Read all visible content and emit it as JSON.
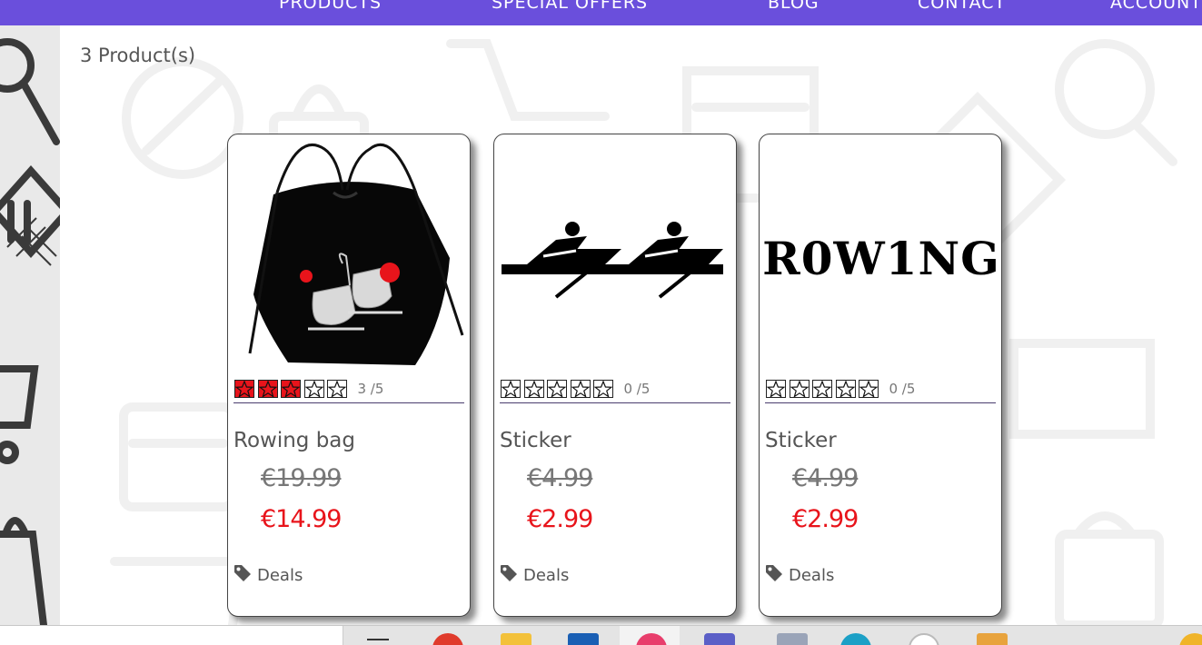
{
  "nav": {
    "items": [
      "PRODUCTS",
      "SPECIAL OFFERS",
      "BLOG",
      "CONTACT",
      "ACCOUNT"
    ]
  },
  "listing": {
    "count_text": "3 Product(s)"
  },
  "products": [
    {
      "name": "Rowing bag",
      "old_price": "€19.99",
      "new_price": "€14.99",
      "rating": 3,
      "rating_text": "3 /5",
      "tag": "Deals",
      "image": "black drawstring bag with ice skates"
    },
    {
      "name": "Sticker",
      "old_price": "€4.99",
      "new_price": "€2.99",
      "rating": 0,
      "rating_text": "0 /5",
      "tag": "Deals",
      "image": "rowing pictogram sticker"
    },
    {
      "name": "Sticker",
      "old_price": "€4.99",
      "new_price": "€2.99",
      "rating": 0,
      "rating_text": "0 /5",
      "tag": "Deals",
      "image_text": "R0W1NG"
    }
  ],
  "colors": {
    "nav_bg": "#6a4fdc",
    "sale_price": "#e8141b",
    "star_filled": "#e8141b"
  }
}
